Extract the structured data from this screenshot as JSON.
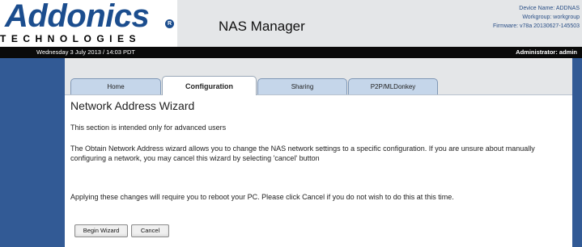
{
  "header": {
    "logo_text": "Addonics",
    "logo_subtext": "TECHNOLOGIES",
    "app_title": "NAS Manager",
    "device_name": "Device Name: ADDNAS",
    "workgroup": "Workgroup: workgroup",
    "firmware": "Firmware: v78a 20130627-145503"
  },
  "statusbar": {
    "datetime": "Wednesday 3 July 2013 / 14:03 PDT",
    "user": "Administrator: admin"
  },
  "tabs": [
    {
      "label": "Home",
      "active": false
    },
    {
      "label": "Configuration",
      "active": true
    },
    {
      "label": "Sharing",
      "active": false
    },
    {
      "label": "P2P/MLDonkey",
      "active": false
    }
  ],
  "main": {
    "title": "Network Address Wizard",
    "intro": "This section is intended only for advanced users",
    "description": "The Obtain Network Address wizard allows you to change the NAS network settings to a specific configuration. If you are unsure about manually configuring a network, you may cancel this wizard by selecting 'cancel' button",
    "reboot_notice": "Applying these changes will require you to reboot your PC. Please click Cancel if you do not wish to do this at this time.",
    "begin_button": "Begin Wizard",
    "cancel_button": "Cancel"
  },
  "colors": {
    "brand_blue": "#1b4d8e",
    "panel_blue": "#325a95",
    "tab_blue": "#c5d6ea",
    "statusbar_black": "#0a0a0a"
  }
}
